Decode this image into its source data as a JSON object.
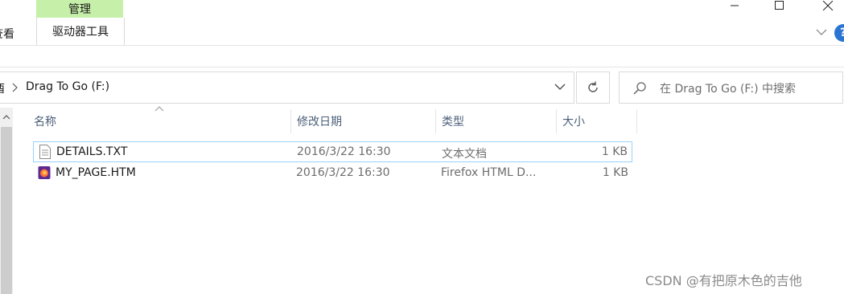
{
  "ribbon": {
    "manage_label": "管理",
    "drive_tools_label": "驱动器工具",
    "view_label_partial": "查看"
  },
  "address_bar": {
    "prev_segment_partial": "酉",
    "path_label": "Drag To Go (F:)"
  },
  "search": {
    "placeholder": "在 Drag To Go (F:) 中搜索"
  },
  "columns": {
    "name": "名称",
    "modified": "修改日期",
    "type": "类型",
    "size": "大小"
  },
  "files": [
    {
      "name": "DETAILS.TXT",
      "modified": "2016/3/22 16:30",
      "type": "文本文档",
      "size": "1 KB",
      "icon": "text-file-icon"
    },
    {
      "name": "MY_PAGE.HTM",
      "modified": "2016/3/22 16:30",
      "type": "Firefox HTML D...",
      "size": "1 KB",
      "icon": "firefox-html-icon"
    }
  ],
  "watermark": "CSDN @有把原木色的吉他",
  "colors": {
    "manage_tab_bg": "#c6efa9",
    "selection_border": "#99d1ff",
    "help_blue": "#2a75d3"
  }
}
